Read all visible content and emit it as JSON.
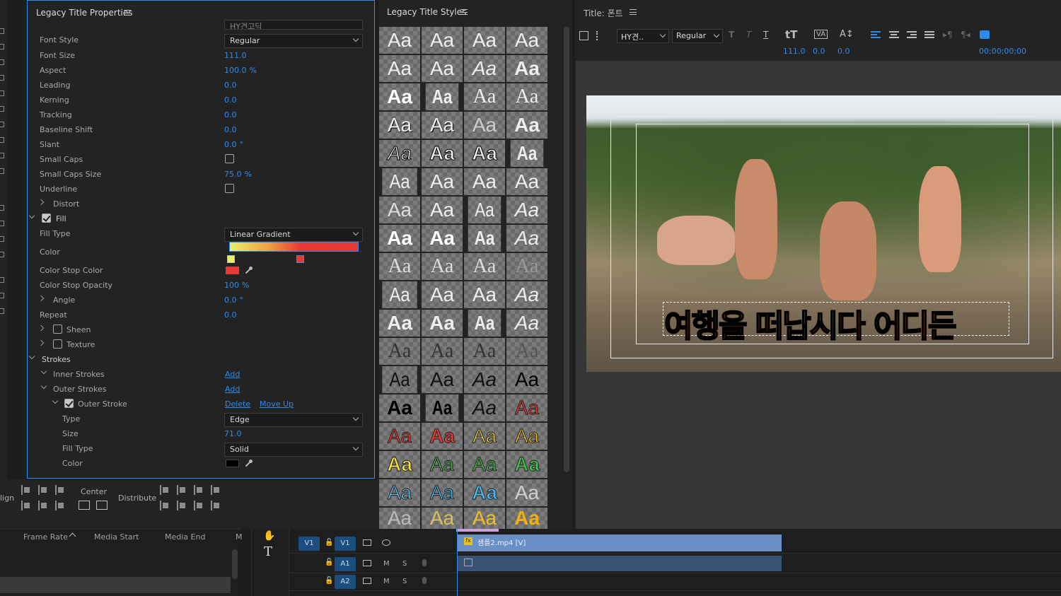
{
  "properties": {
    "title": "Legacy Title Properties",
    "font_family_partial": "HY견고딕",
    "font_style_label": "Font Style",
    "font_style_value": "Regular",
    "rows": [
      {
        "label": "Font Size",
        "value": "111.0",
        "unit": ""
      },
      {
        "label": "Aspect",
        "value": "100.0",
        "unit": "%"
      },
      {
        "label": "Leading",
        "value": "0.0",
        "unit": ""
      },
      {
        "label": "Kerning",
        "value": "0.0",
        "unit": ""
      },
      {
        "label": "Tracking",
        "value": "0.0",
        "unit": ""
      },
      {
        "label": "Baseline Shift",
        "value": "0.0",
        "unit": ""
      },
      {
        "label": "Slant",
        "value": "0.0",
        "unit": "°"
      }
    ],
    "small_caps_label": "Small Caps",
    "small_caps_size_label": "Small Caps Size",
    "small_caps_size_value": "75.0",
    "small_caps_size_unit": "%",
    "underline_label": "Underline",
    "distort_label": "Distort",
    "fill_label": "Fill",
    "fill_type_label": "Fill Type",
    "fill_type_value": "Linear Gradient",
    "color_label": "Color",
    "color_stop_color_label": "Color Stop Color",
    "color_stop_opacity_label": "Color Stop Opacity",
    "color_stop_opacity_value": "100",
    "color_stop_opacity_unit": "%",
    "angle_label": "Angle",
    "angle_value": "0.0",
    "angle_unit": "°",
    "repeat_label": "Repeat",
    "repeat_value": "0.0",
    "sheen_label": "Sheen",
    "texture_label": "Texture",
    "strokes_label": "Strokes",
    "inner_strokes_label": "Inner Strokes",
    "outer_strokes_label": "Outer Strokes",
    "add_label": "Add",
    "outer_stroke_label": "Outer Stroke",
    "delete_label": "Delete",
    "move_up_label": "Move Up",
    "type_label": "Type",
    "type_value": "Edge",
    "size_label": "Size",
    "size_value": "71.0",
    "stroke_fill_type_label": "Fill Type",
    "stroke_fill_type_value": "Solid",
    "stroke_color_label": "Color",
    "colors": {
      "stop_color": "#e53935",
      "stroke_color": "#000000",
      "accent": "#2d8ceb"
    }
  },
  "align": {
    "align_label": "lign",
    "center_label": "Center",
    "distribute_label": "Distribute"
  },
  "styles": {
    "title": "Legacy Title Styles",
    "sample": "Aa"
  },
  "title_panel": {
    "title": "Title:",
    "title_name": "폰트",
    "font_value": "HY견..",
    "style_value": "Regular",
    "font_size_value": "111.0",
    "kerning_value": "0.0",
    "leading_value": "0.0",
    "timecode": "00;00;00;00",
    "caption": "여행을 떠납시다  어디든"
  },
  "project": {
    "col_frame_rate": "Frame Rate",
    "col_media_start": "Media Start",
    "col_media_end": "Media End",
    "col_more": "M"
  },
  "timeline": {
    "v1_src": "V1",
    "v1": "V1",
    "a1": "A1",
    "a2": "A2",
    "m": "M",
    "s": "S",
    "clip_name": "샘플2.mp4 [V]"
  }
}
